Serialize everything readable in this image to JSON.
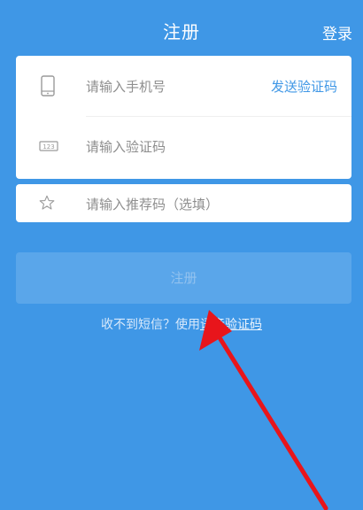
{
  "header": {
    "title": "注册",
    "login_label": "登录"
  },
  "form": {
    "phone_placeholder": "请输入手机号",
    "send_code_label": "发送验证码",
    "code_placeholder": "请输入验证码",
    "code_icon_text": "123",
    "referral_placeholder": "请输入推荐码（选填）"
  },
  "register_button_label": "注册",
  "hint": {
    "text": "收不到短信？使用",
    "link": "语音验证码"
  },
  "colors": {
    "background": "#3f97e6",
    "accent": "#3f97e6",
    "arrow": "#e8151b"
  },
  "icons": {
    "phone": "phone-icon",
    "code": "keypad-icon",
    "referral": "star-icon"
  }
}
